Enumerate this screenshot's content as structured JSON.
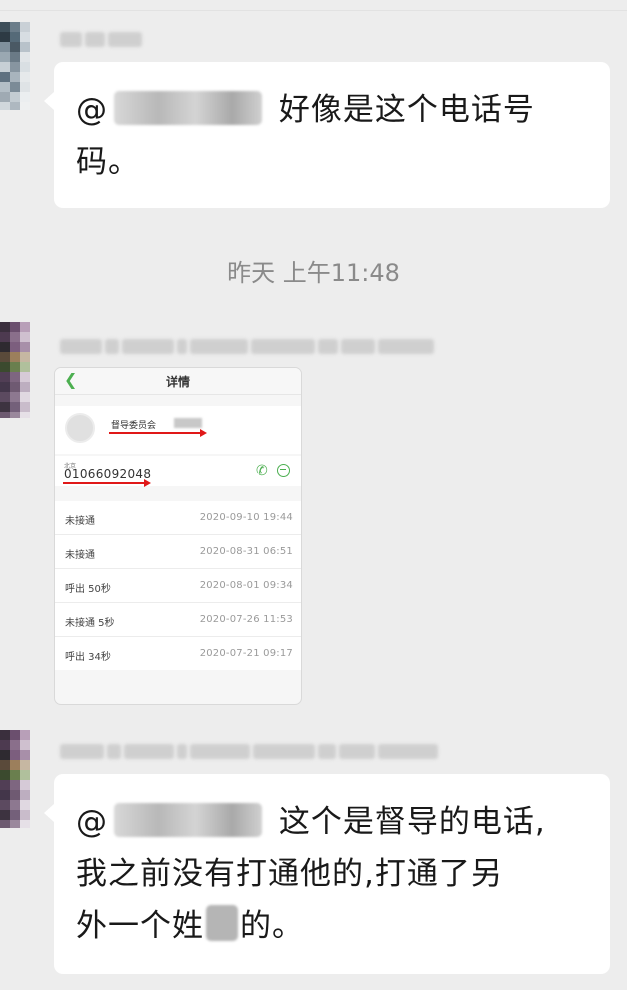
{
  "messages": [
    {
      "type": "text",
      "mention": "@",
      "text_line1": "好像是这个电话号",
      "text_line2": "码。"
    },
    {
      "type": "timestamp",
      "text": "昨天 上午11:48"
    },
    {
      "type": "image",
      "screenshot": {
        "back_icon": "chevron-left-icon",
        "title": "详情",
        "contact_name": "督导委员会",
        "location": "北京",
        "phone_number": "01066092048",
        "accent_color": "#4caf50",
        "annotation_color": "#e01818",
        "call_records": [
          {
            "type": "未接通",
            "datetime": "2020-09-10  19:44"
          },
          {
            "type": "未接通",
            "datetime": "2020-08-31  06:51"
          },
          {
            "type": "呼出  50秒",
            "datetime": "2020-08-01  09:34"
          },
          {
            "type": "未接通 5秒",
            "datetime": "2020-07-26  11:53"
          },
          {
            "type": "呼出  34秒",
            "datetime": "2020-07-21  09:17"
          }
        ]
      }
    },
    {
      "type": "text",
      "mention": "@",
      "text_line1": "这个是督导的电话,",
      "text_line2": "我之前没有打通他的,打通了另",
      "text_line3_before": "外一个姓",
      "text_line3_after": "的。"
    }
  ]
}
